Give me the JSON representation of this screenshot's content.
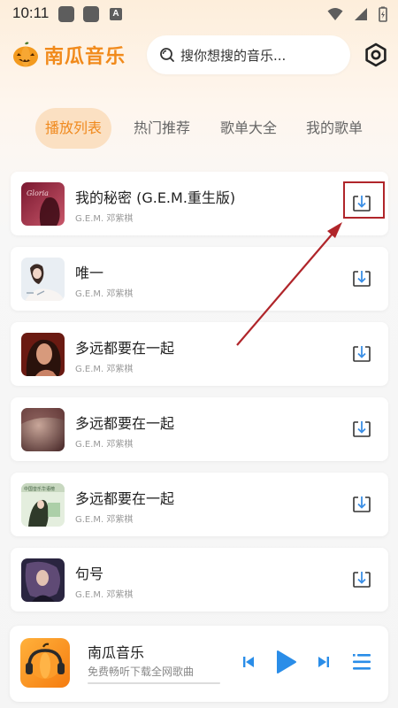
{
  "status_bar": {
    "time": "10:11",
    "a_badge": "A"
  },
  "header": {
    "app_name": "南瓜音乐",
    "search_placeholder": "搜你想搜的音乐...",
    "icons": [
      "pumpkin-logo-icon",
      "search-icon",
      "settings-hexagon-icon"
    ]
  },
  "tabs": [
    {
      "label": "播放列表",
      "active": true
    },
    {
      "label": "热门推荐",
      "active": false
    },
    {
      "label": "歌单大全",
      "active": false
    },
    {
      "label": "我的歌单",
      "active": false
    }
  ],
  "songs": [
    {
      "title": "我的秘密 (G.E.M.重生版)",
      "artist": "G.E.M. 邓紫棋",
      "cover_label": "Gloria",
      "highlighted": true
    },
    {
      "title": "唯一",
      "artist": "G.E.M. 邓紫棋",
      "cover_label": "",
      "highlighted": false
    },
    {
      "title": "多远都要在一起",
      "artist": "G.E.M. 邓紫棋",
      "cover_label": "",
      "highlighted": false
    },
    {
      "title": "多远都要在一起",
      "artist": "G.E.M. 邓紫棋",
      "cover_label": "",
      "highlighted": false
    },
    {
      "title": "多远都要在一起",
      "artist": "G.E.M. 邓紫棋",
      "cover_label": "中国音乐华语榜",
      "highlighted": false
    },
    {
      "title": "句号",
      "artist": "G.E.M. 邓紫棋",
      "cover_label": "",
      "highlighted": false
    }
  ],
  "player": {
    "title": "南瓜音乐",
    "subtitle": "免费畅听下载全网歌曲",
    "progress": 0.0,
    "icons": [
      "pumpkin-headphones-icon",
      "previous-icon",
      "play-icon",
      "next-icon",
      "playlist-icon"
    ]
  },
  "colors": {
    "accent": "#f0891d",
    "tab_active_bg": "#fbe0c2",
    "download_icon": "#3a8ee6",
    "annotation_red": "#b0252a"
  }
}
